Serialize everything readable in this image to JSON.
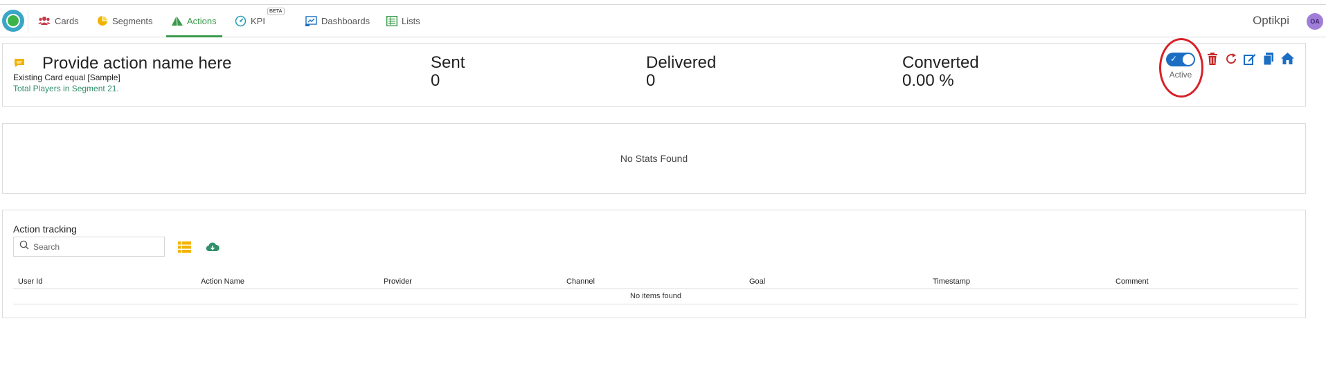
{
  "nav": {
    "items": [
      {
        "label": "Cards",
        "icon": "users-icon"
      },
      {
        "label": "Segments",
        "icon": "pie-chart-icon"
      },
      {
        "label": "Actions",
        "icon": "paper-plane-icon"
      },
      {
        "label": "KPI",
        "icon": "gauge-icon",
        "badge": "BETA"
      },
      {
        "label": "Dashboards",
        "icon": "dashboard-icon"
      },
      {
        "label": "Lists",
        "icon": "list-icon"
      }
    ],
    "active": "Actions",
    "brand": "Optikpi",
    "avatar_initials": "OA"
  },
  "action": {
    "title": "Provide action name here",
    "condition": "Existing Card equal [Sample]",
    "total_players": "Total Players in Segment 21.",
    "stats": [
      {
        "label": "Sent",
        "value": "0"
      },
      {
        "label": "Delivered",
        "value": "0"
      },
      {
        "label": "Converted",
        "value": "0.00 %"
      }
    ],
    "status_label": "Active",
    "status_on": true
  },
  "stats_panel": {
    "message": "No Stats Found"
  },
  "tracking": {
    "title": "Action tracking",
    "search_placeholder": "Search",
    "columns": [
      "User Id",
      "Action Name",
      "Provider",
      "Channel",
      "Goal",
      "Timestamp",
      "Comment"
    ],
    "empty_message": "No items found"
  },
  "colors": {
    "accent": "#3a9a4a",
    "toggle": "#1b6ec2",
    "delete": "#c62828",
    "link_blue": "#1b6ec2",
    "annotation": "#d62128"
  }
}
